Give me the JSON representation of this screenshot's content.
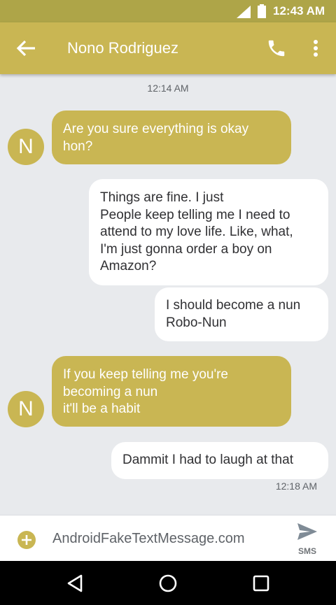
{
  "status_bar": {
    "time": "12:43 AM",
    "signal_icon": "signal-icon",
    "battery_icon": "battery-icon"
  },
  "app_bar": {
    "back_icon": "arrow-left-icon",
    "title": "Nono Rodriguez",
    "call_icon": "phone-icon",
    "menu_icon": "more-vert-icon"
  },
  "thread": {
    "timestamp_top": "12:14 AM",
    "messages": [
      {
        "direction": "incoming",
        "avatar": "N",
        "text": "Are you sure everything is okay\nhon?"
      },
      {
        "direction": "outgoing",
        "text": "Things are fine. I just\nPeople keep telling me I need to\nattend to my love life. Like, what,\nI'm just gonna order a boy on\nAmazon?"
      },
      {
        "direction": "outgoing",
        "text": "I should become a nun\nRobo-Nun"
      },
      {
        "direction": "incoming",
        "avatar": "N",
        "text": "If you keep telling me you're\nbecoming a nun\nit'll be a habit"
      },
      {
        "direction": "outgoing",
        "text": "Dammit I had to laugh at that"
      }
    ],
    "timestamp_bottom": "12:18 AM"
  },
  "composer": {
    "add_icon": "add-circle-icon",
    "placeholder": "AndroidFakeTextMessage.com",
    "send_icon": "send-icon",
    "send_label": "SMS"
  },
  "nav_bar": {
    "back_icon": "nav-back-icon",
    "home_icon": "nav-home-icon",
    "recents_icon": "nav-recents-icon"
  },
  "colors": {
    "accent": "#c9b653",
    "status_bar": "#aea548",
    "background": "#e8eaed",
    "outgoing_bubble": "#ffffff"
  }
}
